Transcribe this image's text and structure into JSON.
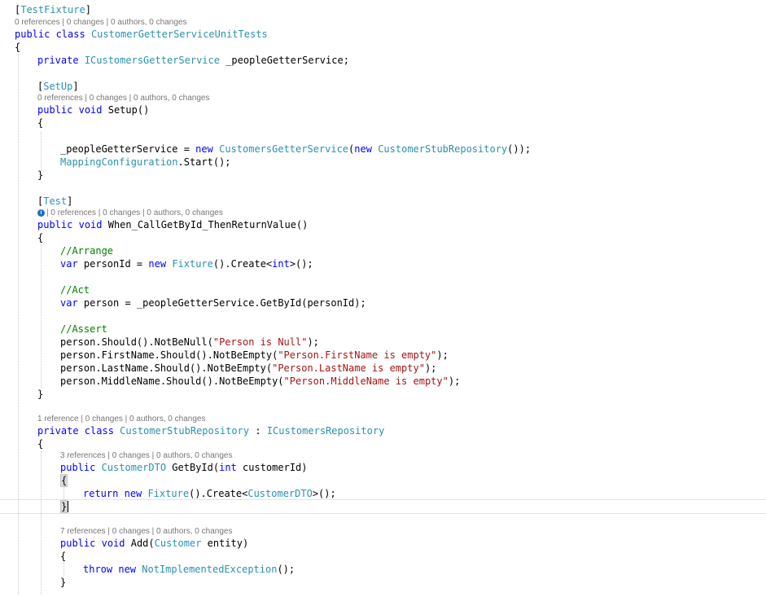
{
  "lens": {
    "l1": "0 references | 0 changes | 0 authors, 0 changes",
    "l2": "0 references | 0 changes | 0 authors, 0 changes",
    "l3": "| 0 references | 0 changes | 0 authors, 0 changes",
    "l4": "1 reference | 0 changes | 0 authors, 0 changes",
    "l5": "3 references | 0 changes | 0 authors, 0 changes",
    "l6": "7 references | 0 changes | 0 authors, 0 changes"
  },
  "icons": {
    "test_info": "info-icon"
  },
  "code": {
    "attr_testfixture": "TestFixture",
    "class_decl_kw": "public class",
    "class_name": "CustomerGetterServiceUnitTests",
    "open_brace": "{",
    "close_brace": "}",
    "field_kw": "private",
    "field_type": "ICustomersGetterService",
    "field_rest": " _peopleGetterService;",
    "attr_setup": "SetUp",
    "kw_public": "public",
    "kw_void": "void",
    "setup_sig": " Setup()",
    "assign_lhs": "_peopleGetterService = ",
    "kw_new": "new",
    "type_cgs": "CustomersGetterService",
    "type_csr": "CustomerStubRepository",
    "assign_tail": "());",
    "mapping_type": "MappingConfiguration",
    "mapping_rest": ".Start();",
    "attr_test": "Test",
    "test_sig": " When_CallGetById_ThenReturnValue()",
    "cm_arrange": "//Arrange",
    "kw_var": "var",
    "arrange_mid": " personId = ",
    "type_fixture": "Fixture",
    "create_open": "().Create<",
    "kw_int": "int",
    "create_close": ">();",
    "cm_act": "//Act",
    "act_rest": " person = _peopleGetterService.GetById(personId);",
    "cm_assert": "//Assert",
    "a1_pre": "person.Should().NotBeNull(",
    "a1_str": "\"Person is Null\"",
    "a2_pre": "person.FirstName.Should().NotBeEmpty(",
    "a2_str": "\"Person.FirstName is empty\"",
    "a3_pre": "person.LastName.Should().NotBeEmpty(",
    "a3_str": "\"Person.LastName is empty\"",
    "a4_pre": "person.MiddleName.Should().NotBeEmpty(",
    "a4_str": "\"Person.MiddleName is empty\"",
    "stmt_end": ");",
    "kw_private_class": "private class",
    "colon": " : ",
    "type_icr": "ICustomersRepository",
    "type_dto": "CustomerDTO",
    "getbyid_sig": " GetById(",
    "param_name": " customerId)",
    "kw_return": "return",
    "add_sig": " Add(",
    "type_customer": "Customer",
    "add_param": " entity)",
    "kw_throw": "throw",
    "type_nie": "NotImplementedException",
    "throw_tail": "();"
  }
}
